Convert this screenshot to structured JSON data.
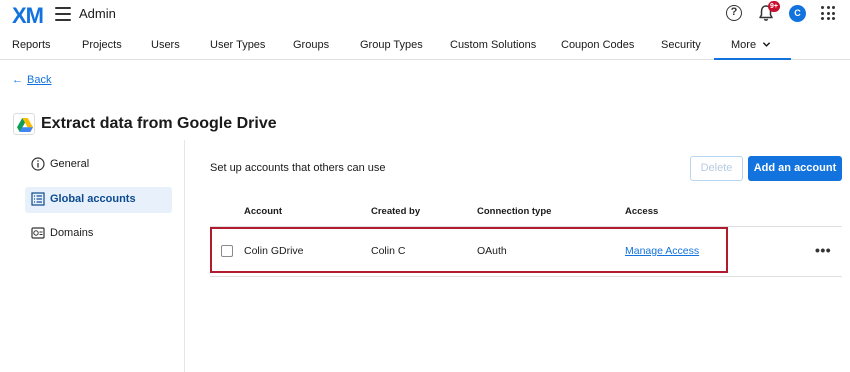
{
  "topbar": {
    "logo": "XM",
    "title": "Admin",
    "notifications": "9+",
    "avatar_initial": "C"
  },
  "nav": {
    "items": [
      {
        "label": "Reports"
      },
      {
        "label": "Projects"
      },
      {
        "label": "Users"
      },
      {
        "label": "User Types"
      },
      {
        "label": "Groups"
      },
      {
        "label": "Group Types"
      },
      {
        "label": "Custom Solutions"
      },
      {
        "label": "Coupon Codes"
      },
      {
        "label": "Security"
      }
    ],
    "more_label": "More"
  },
  "back_label": "Back",
  "page_title": "Extract data from Google Drive",
  "sidebar": {
    "items": [
      {
        "label": "General",
        "icon": "info-icon"
      },
      {
        "label": "Global accounts",
        "icon": "list-icon"
      },
      {
        "label": "Domains",
        "icon": "domains-icon"
      }
    ],
    "active": "Global accounts"
  },
  "content": {
    "intro": "Set up accounts that others can use",
    "delete_label": "Delete",
    "add_label": "Add an account"
  },
  "table": {
    "headers": [
      "Account",
      "Created by",
      "Connection type",
      "Access"
    ],
    "rows": [
      {
        "account": "Colin GDrive",
        "created_by": "Colin C",
        "connection_type": "OAuth",
        "access": "Manage Access"
      }
    ]
  },
  "colors": {
    "accent": "#1273de",
    "highlight": "#b01c2e",
    "badge": "#c8102e"
  }
}
